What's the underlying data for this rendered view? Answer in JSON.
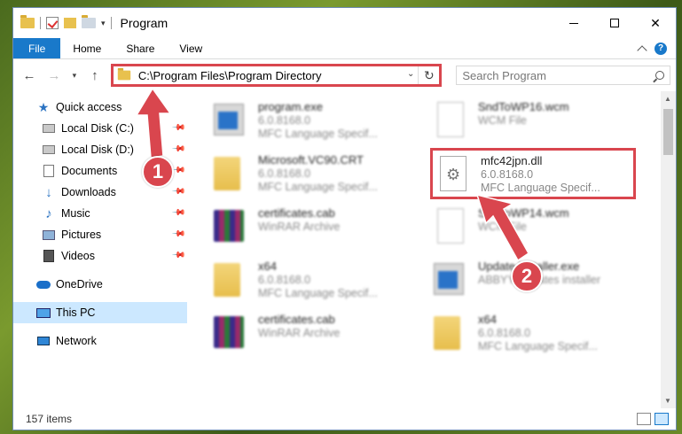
{
  "window": {
    "title": "Program",
    "controls": {
      "minimize": "",
      "maximize": "",
      "close": "✕"
    }
  },
  "ribbon": {
    "tabs": [
      "File",
      "Home",
      "Share",
      "View"
    ],
    "help": "?"
  },
  "address": {
    "path": "C:\\Program Files\\Program Directory",
    "search_placeholder": "Search Program"
  },
  "nav": {
    "items": [
      {
        "label": "Quick access",
        "icon": "star-icon"
      },
      {
        "label": "Local Disk (C:)",
        "icon": "disk-icon",
        "pinned": true
      },
      {
        "label": "Local Disk (D:)",
        "icon": "disk-icon",
        "pinned": true
      },
      {
        "label": "Documents",
        "icon": "documents-icon",
        "pinned": true
      },
      {
        "label": "Downloads",
        "icon": "download-icon",
        "pinned": true
      },
      {
        "label": "Music",
        "icon": "music-icon",
        "pinned": true
      },
      {
        "label": "Pictures",
        "icon": "pictures-icon",
        "pinned": true
      },
      {
        "label": "Videos",
        "icon": "video-icon",
        "pinned": true
      },
      {
        "label": "OneDrive",
        "icon": "cloud-icon"
      },
      {
        "label": "This PC",
        "icon": "pc-icon",
        "selected": true
      },
      {
        "label": "Network",
        "icon": "network-icon"
      }
    ]
  },
  "files": [
    {
      "name": "program.exe",
      "line2": "6.0.8168.0",
      "line3": "MFC Language Specif...",
      "icon": "exe-icon"
    },
    {
      "name": "SndToWP16.wcm",
      "line2": "WCM File",
      "line3": "",
      "icon": "file-icon"
    },
    {
      "name": "Microsoft.VC90.CRT",
      "line2": "6.0.8168.0",
      "line3": "MFC Language Specif...",
      "icon": "folder-icon"
    },
    {
      "name": "mfc42jpn.dll",
      "line2": "6.0.8168.0",
      "line3": "MFC Language Specif...",
      "icon": "dll-icon"
    },
    {
      "name": "certificates.cab",
      "line2": "WinRAR Archive",
      "line3": "",
      "icon": "rar-icon"
    },
    {
      "name": "SndToWP14.wcm",
      "line2": "WCM File",
      "line3": "",
      "icon": "file-icon"
    },
    {
      "name": "x64",
      "line2": "6.0.8168.0",
      "line3": "MFC Language Specif...",
      "icon": "folder-icon"
    },
    {
      "name": "Update installer.exe",
      "line2": "ABBYY Updates installer",
      "line3": "",
      "icon": "exe-icon"
    },
    {
      "name": "certificates.cab",
      "line2": "WinRAR Archive",
      "line3": "",
      "icon": "rar-icon"
    },
    {
      "name": "x64",
      "line2": "6.0.8168.0",
      "line3": "MFC Language Specif...",
      "icon": "folder-icon"
    }
  ],
  "status": {
    "count": "157 items"
  },
  "annotations": {
    "badge1": "1",
    "badge2": "2",
    "color": "#d9464e"
  }
}
